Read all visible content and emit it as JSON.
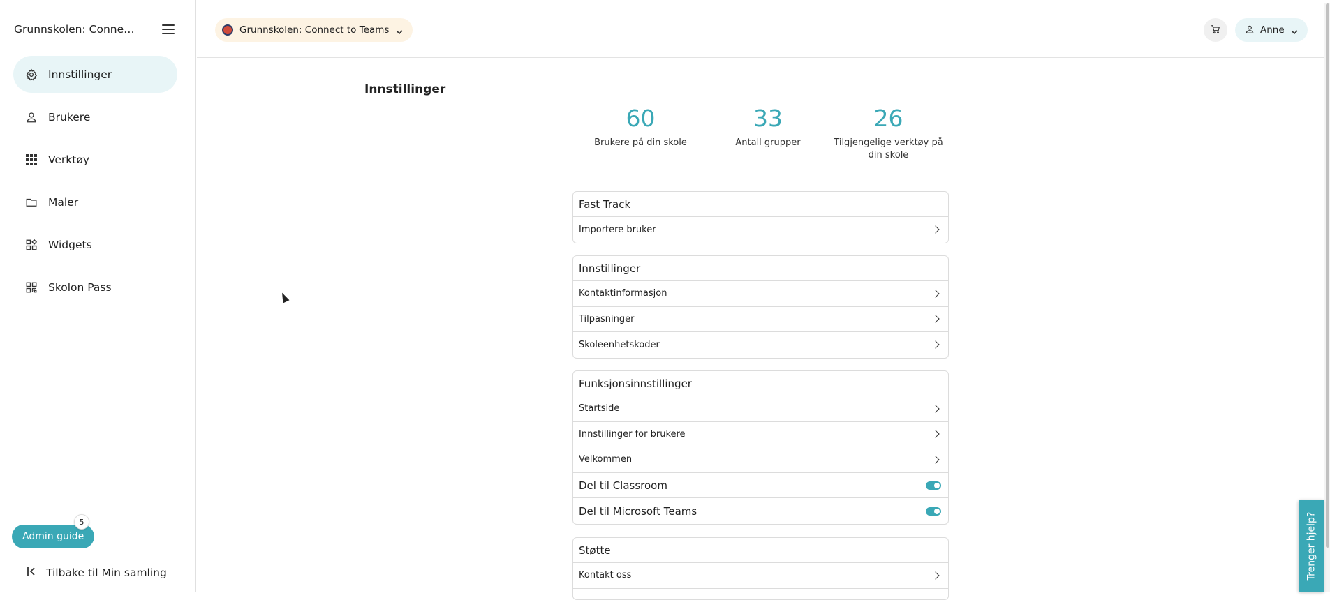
{
  "sidebar": {
    "title": "Grunnskolen: Connect t...",
    "items": [
      {
        "label": "Innstillinger",
        "icon": "gear-icon",
        "active": true
      },
      {
        "label": "Brukere",
        "icon": "person-icon",
        "active": false
      },
      {
        "label": "Verktøy",
        "icon": "apps-grid-icon",
        "active": false
      },
      {
        "label": "Maler",
        "icon": "folder-icon",
        "active": false
      },
      {
        "label": "Widgets",
        "icon": "widgets-icon",
        "active": false
      },
      {
        "label": "Skolon Pass",
        "icon": "qr-code-icon",
        "active": false
      }
    ],
    "admin_guide_label": "Admin guide",
    "admin_guide_badge": "5",
    "back_label": "Tilbake til Min samling"
  },
  "header": {
    "school_name": "Grunnskolen: Connect to Teams",
    "user_name": "Anne"
  },
  "main": {
    "page_title": "Innstillinger",
    "stats": [
      {
        "value": "60",
        "label": "Brukere på din skole"
      },
      {
        "value": "33",
        "label": "Antall grupper"
      },
      {
        "value": "26",
        "label": "Tilgjengelige verktøy på din skole"
      }
    ],
    "cards": {
      "fast_track": {
        "title": "Fast Track",
        "rows": [
          "Importere bruker"
        ]
      },
      "innstillinger": {
        "title": "Innstillinger",
        "rows": [
          "Kontaktinformasjon",
          "Tilpasninger",
          "Skoleenhetskoder"
        ]
      },
      "funksjon": {
        "title": "Funksjonsinnstillinger",
        "rows": [
          "Startside",
          "Innstillinger for brukere",
          "Velkommen"
        ],
        "toggles": [
          {
            "label": "Del til Classroom",
            "on": true
          },
          {
            "label": "Del til Microsoft Teams",
            "on": true
          }
        ]
      },
      "stotte": {
        "title": "Støtte",
        "rows": [
          "Kontakt oss"
        ]
      }
    }
  },
  "help_tab_label": "Trenger hjelp?",
  "colors": {
    "accent": "#3aa8b6",
    "active_bg": "#e8f5f7",
    "school_chip_bg": "#fdf3e3"
  }
}
